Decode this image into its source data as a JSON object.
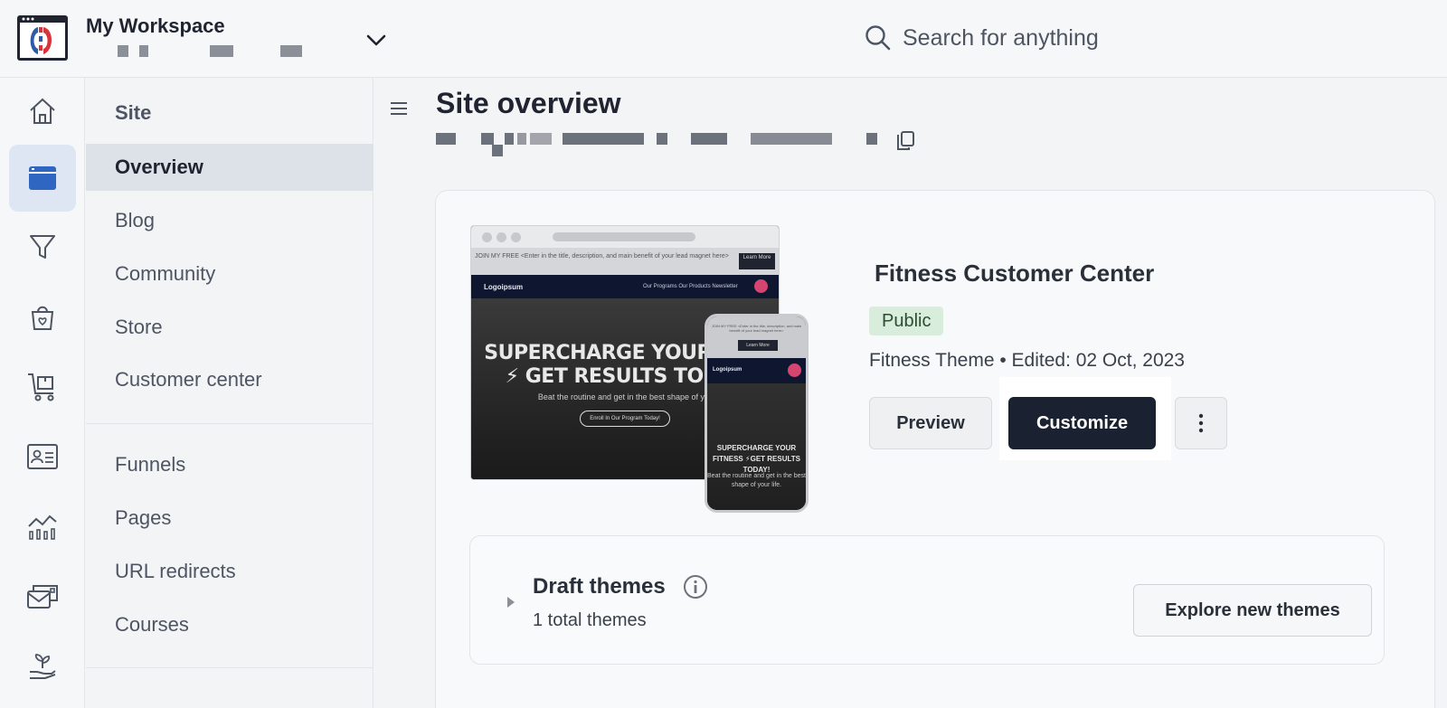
{
  "header": {
    "workspace_name": "My Workspace",
    "search_placeholder": "Search for anything"
  },
  "sidebar": {
    "section_title": "Site",
    "items": [
      {
        "label": "Overview",
        "active": true
      },
      {
        "label": "Blog"
      },
      {
        "label": "Community"
      },
      {
        "label": "Store"
      },
      {
        "label": "Customer center"
      }
    ],
    "items2": [
      {
        "label": "Funnels"
      },
      {
        "label": "Pages"
      },
      {
        "label": "URL redirects"
      },
      {
        "label": "Courses"
      }
    ]
  },
  "rail": {
    "icons": [
      "home-icon",
      "browser-window-icon",
      "funnel-icon",
      "store-bag-icon",
      "cart-icon",
      "contact-card-icon",
      "analytics-icon",
      "mail-card-icon",
      "plant-hand-icon"
    ]
  },
  "main": {
    "page_title": "Site overview",
    "site": {
      "title": "Fitness Customer Center",
      "status": "Public",
      "meta": "Fitness Theme • Edited: 02 Oct, 2023",
      "preview_label": "Preview",
      "customize_label": "Customize"
    },
    "draft": {
      "title": "Draft themes",
      "count": "1 total themes",
      "explore_label": "Explore new themes"
    },
    "thumbnail": {
      "banner": "JOIN MY FREE <Enter in the title, description, and main benefit of your lead magnet here>",
      "learn_more": "Learn More",
      "brand": "Logoipsum",
      "nav_links": "Our Programs   Our Products   Newsletter",
      "avatar": "MB",
      "hero_line1": "SUPERCHARGE YOUR FITN",
      "hero_line2": "⚡ GET RESULTS TODAY",
      "hero_sub": "Beat the routine and get in the best shape of you",
      "hero_cta": "Enroll In Our Program Today!",
      "phone_banner": "JOIN MY FREE <Enter in the title, description, and main benefit of your lead magnet here>",
      "phone_hero": "SUPERCHARGE YOUR FITNESS ⚡GET RESULTS TODAY!",
      "phone_sub": "Beat the routine and get in the best shape of your life."
    }
  },
  "colors": {
    "primary_button": "#1a2130",
    "badge_bg": "#d9eddc",
    "active_rail": "#dde6f2"
  }
}
